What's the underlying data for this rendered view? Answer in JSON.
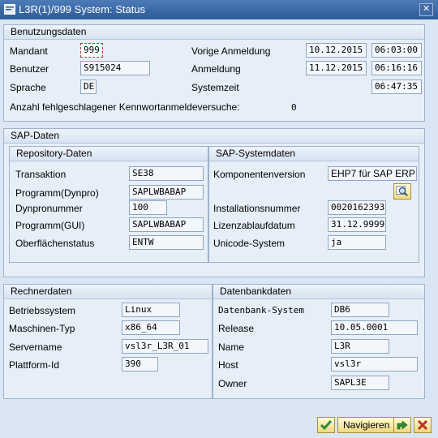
{
  "window": {
    "title": "L3R(1)/999 System: Status",
    "close_glyph": "✕"
  },
  "benutzungsdaten": {
    "title": "Benutzungsdaten",
    "mandant_label": "Mandant",
    "mandant": "999",
    "benutzer_label": "Benutzer",
    "benutzer": "S915024",
    "sprache_label": "Sprache",
    "sprache": "DE",
    "vorige_label": "Vorige Anmeldung",
    "vorige_datum": "10.12.2015",
    "vorige_zeit": "06:03:00",
    "anmeldung_label": "Anmeldung",
    "anmeldung_datum": "11.12.2015",
    "anmeldung_zeit": "06:16:16",
    "systemzeit_label": "Systemzeit",
    "systemzeit": "06:47:35",
    "fehl_label": "Anzahl fehlgeschlagener Kennwortanmeldeversuche:",
    "fehl_value": "0"
  },
  "sapdaten": {
    "title": "SAP-Daten",
    "repo": {
      "title": "Repository-Daten",
      "transaktion_label": "Transaktion",
      "transaktion": "SE38",
      "programm_dynpro_label": "Programm(Dynpro)",
      "programm_dynpro": "SAPLWBABAP",
      "dynpronummer_label": "Dynpronummer",
      "dynpronummer": "100",
      "programm_gui_label": "Programm(GUI)",
      "programm_gui": "SAPLWBABAP",
      "oberflaechen_label": "Oberflächenstatus",
      "oberflaechen": "ENTW"
    },
    "system": {
      "title": "SAP-Systemdaten",
      "komponenten_label": "Komponentenversion",
      "komponenten": "EHP7 für SAP ERP ...",
      "details_icon": "magnifier-icon",
      "installation_label": "Installationsnummer",
      "installation": "0020162393",
      "lizenz_label": "Lizenzablaufdatum",
      "lizenz": "31.12.9999",
      "unicode_label": "Unicode-System",
      "unicode": "ja"
    }
  },
  "rechnerdaten": {
    "title": "Rechnerdaten",
    "betriebssystem_label": "Betriebssystem",
    "betriebssystem": "Linux",
    "maschinentyp_label": "Maschinen-Typ",
    "maschinentyp": "x86_64",
    "servername_label": "Servername",
    "servername": "vsl3r_L3R_01",
    "plattform_label": "Plattform-Id",
    "plattform": "390"
  },
  "datenbankdaten": {
    "title": "Datenbankdaten",
    "system_label": "Datenbank-System",
    "system": "DB6",
    "release_label": "Release",
    "release": "10.05.0001",
    "name_label": "Name",
    "name": "L3R",
    "host_label": "Host",
    "host": "vsl3r",
    "owner_label": "Owner",
    "owner": "SAPL3E"
  },
  "footer": {
    "navigieren_label": "Navigieren",
    "icons": [
      "check-icon",
      "navigate-icon",
      "cancel-icon"
    ],
    "colors": {
      "check": "#2e8a2e",
      "cancel": "#c03020"
    }
  }
}
